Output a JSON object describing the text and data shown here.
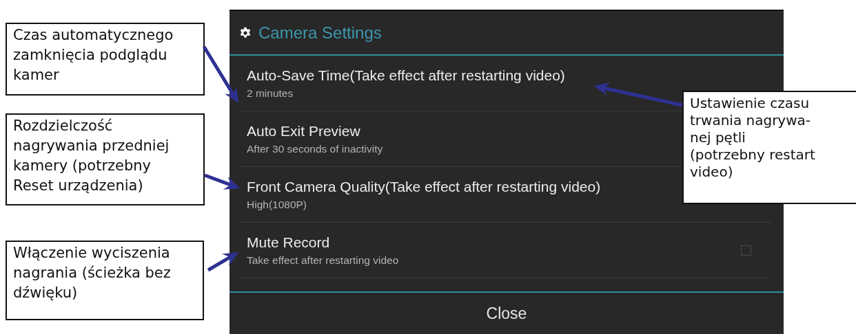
{
  "dialog": {
    "title": "Camera Settings",
    "settings": [
      {
        "kind": "value",
        "title": "Auto-Save Time(Take effect after restarting video)",
        "summary": "2 minutes"
      },
      {
        "kind": "value",
        "title": "Auto Exit Preview",
        "summary": "After 30 seconds of inactivity"
      },
      {
        "kind": "value",
        "title": "Front Camera Quality(Take effect after restarting video)",
        "summary": "High(1080P)"
      },
      {
        "kind": "checkbox",
        "title": "Mute Record",
        "summary": "Take effect after restarting video",
        "checked": false
      }
    ],
    "close_button": "Close"
  },
  "callouts": [
    {
      "text": "Czas automatycznego zamknięcia podglądu kamer"
    },
    {
      "text": "Rozdzielczość nagrywania przedniej kamery (potrzebny Reset urządzenia)"
    },
    {
      "text": "Włączenie wyciszenia nagrania (ścieżka bez dźwięku)"
    },
    {
      "text": "Ustawienie czasu\ntrwania nagrywa-\nnej pętli\n(potrzebny restart\nvideo)"
    }
  ]
}
